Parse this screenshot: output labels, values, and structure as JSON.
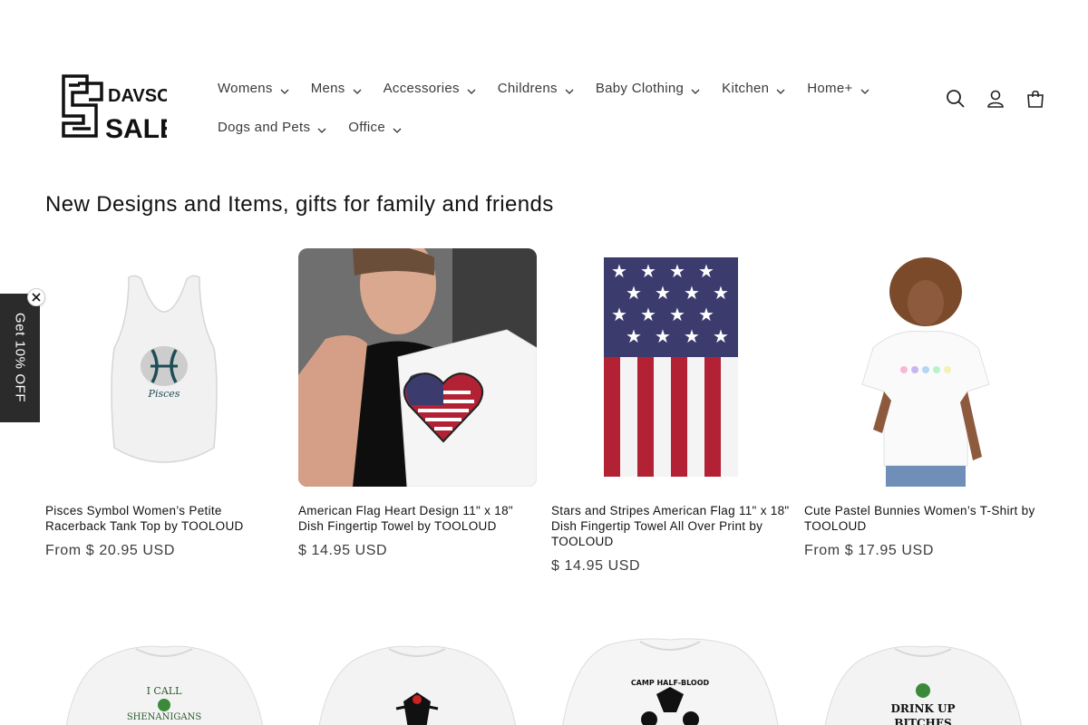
{
  "brand": {
    "logo_text_top": "DAVSON",
    "logo_text_bottom": "SALES"
  },
  "nav": {
    "row1": [
      {
        "label": "Womens"
      },
      {
        "label": "Mens"
      },
      {
        "label": "Accessories"
      },
      {
        "label": "Childrens"
      },
      {
        "label": "Baby Clothing"
      },
      {
        "label": "Kitchen"
      },
      {
        "label": "Home+"
      }
    ],
    "row2": [
      {
        "label": "Dogs and Pets"
      },
      {
        "label": "Office"
      }
    ]
  },
  "header_icons": [
    "search-icon",
    "account-icon",
    "cart-icon"
  ],
  "section": {
    "title": "New Designs and Items, gifts for family and friends"
  },
  "products": [
    {
      "title": "Pisces Symbol Women’s Petite Racerback Tank Top by TOOLOUD",
      "price": "From $ 20.95 USD",
      "image_text": "Pisces"
    },
    {
      "title": "American Flag Heart Design 11\" x 18\" Dish Fingertip Towel by TOOLOUD",
      "price": "$ 14.95 USD"
    },
    {
      "title": "Stars and Stripes American Flag 11\" x 18\" Dish Fingertip Towel All Over Print by TOOLOUD",
      "price": "$ 14.95 USD"
    },
    {
      "title": "Cute Pastel Bunnies Women’s T-Shirt by TOOLOUD",
      "price": "From $ 17.95 USD"
    }
  ],
  "products_row2": [
    {
      "image_text_1": "I CALL",
      "image_text_2": "SHENANIGANS"
    },
    {
      "image_text_1": "",
      "image_text_2": ""
    },
    {
      "image_text_1": "CAMP HALF-BLOOD",
      "image_text_2": ""
    },
    {
      "image_text_1": "DRINK UP",
      "image_text_2": "BITCHES"
    }
  ],
  "promo": {
    "label": "Get 10% OFF"
  },
  "colors": {
    "text": "#121212",
    "promo_bg": "#2b2b2b",
    "flag_red": "#b22234",
    "flag_blue": "#3c3b6e"
  }
}
